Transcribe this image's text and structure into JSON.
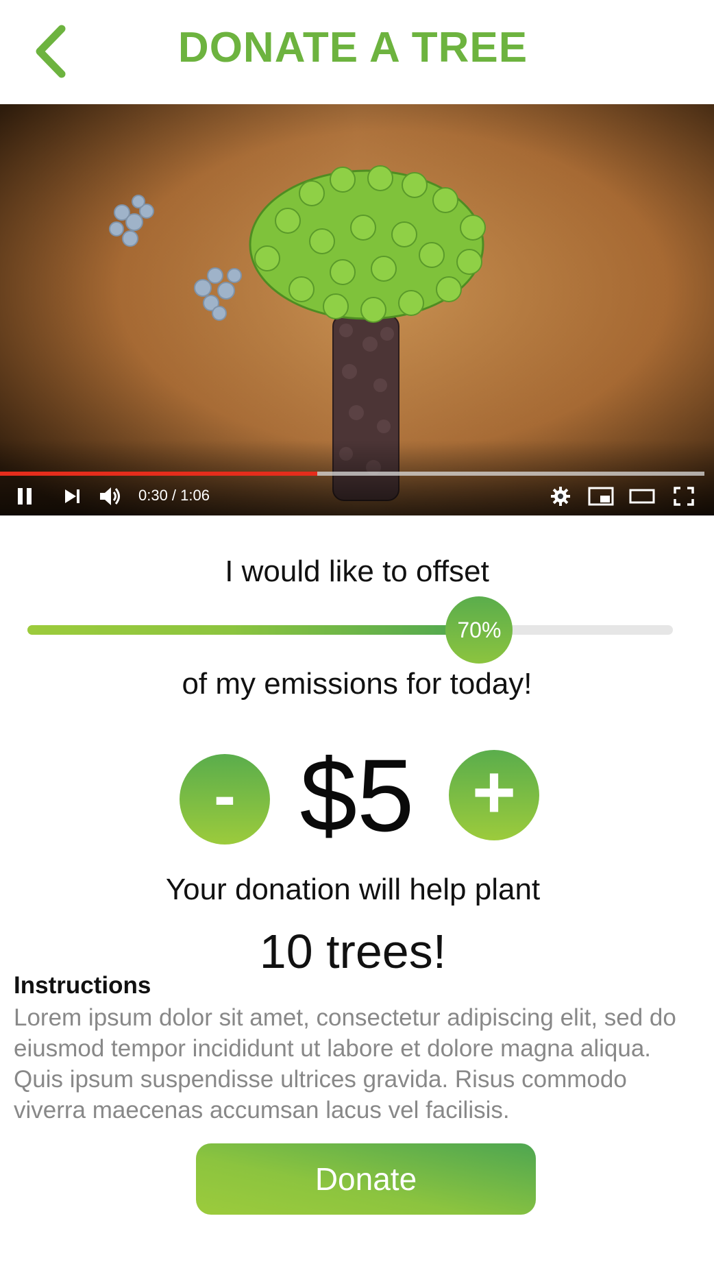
{
  "header": {
    "title": "DONATE A TREE",
    "back_icon": "chevron-left-icon"
  },
  "video": {
    "time_display": "0:30 / 1:06",
    "progress_fraction": 0.45,
    "controls": [
      "pause-icon",
      "next-icon",
      "volume-icon",
      "settings-icon",
      "miniplayer-icon",
      "theater-icon",
      "fullscreen-icon"
    ],
    "colors": {
      "played": "#e52d1c"
    }
  },
  "offset": {
    "lead_text": "I would like to offset",
    "percent_label": "70%",
    "percent_value": 0.7,
    "tail_text": "of my emissions for today!"
  },
  "donation": {
    "minus_label": "-",
    "plus_label": "+",
    "amount": "$5",
    "help_text": "Your donation will help plant",
    "trees_text": "10 trees!"
  },
  "instructions": {
    "title": "Instructions",
    "body": "Lorem ipsum dolor sit amet, consectetur adipiscing elit, sed do eiusmod tempor incididunt ut labore et dolore magna aliqua. Quis ipsum suspendisse ultrices gravida. Risus commodo viverra maecenas accumsan lacus vel facilisis."
  },
  "actions": {
    "donate_label": "Donate"
  },
  "colors": {
    "accent": "#6db33f",
    "button_top": "#5aad4c",
    "button_bottom": "#9ccb3c"
  }
}
